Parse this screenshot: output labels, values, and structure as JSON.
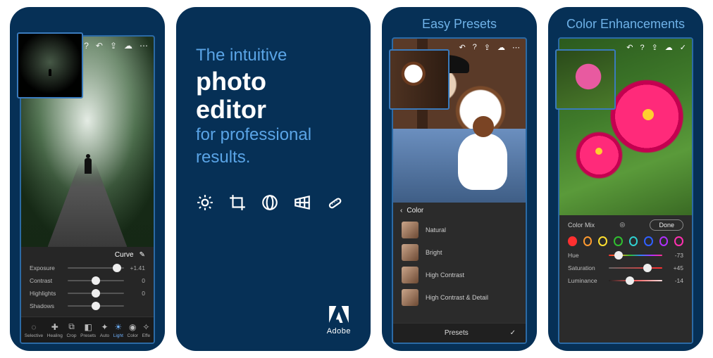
{
  "panel1": {
    "top_icons": [
      "help-icon",
      "undo-icon",
      "share-icon",
      "cloud-icon",
      "more-icon"
    ],
    "edit_header_label": "Curve",
    "sliders": [
      {
        "label": "Exposure",
        "value": "+1.41",
        "pos": 88
      },
      {
        "label": "Contrast",
        "value": "0",
        "pos": 50
      },
      {
        "label": "Highlights",
        "value": "0",
        "pos": 50
      },
      {
        "label": "Shadows",
        "value": "",
        "pos": 50
      }
    ],
    "bottom_tools": [
      {
        "name": "selective",
        "label": "Selective"
      },
      {
        "name": "healing",
        "label": "Healing"
      },
      {
        "name": "crop",
        "label": "Crop"
      },
      {
        "name": "presets",
        "label": "Presets"
      },
      {
        "name": "auto",
        "label": "Auto"
      },
      {
        "name": "light",
        "label": "Light"
      },
      {
        "name": "color",
        "label": "Color"
      },
      {
        "name": "effects",
        "label": "Effe"
      }
    ],
    "active_tool": "light"
  },
  "panel2": {
    "line1": "The intuitive",
    "line2": "photo",
    "line3": "editor",
    "line4": "for professional",
    "line5": "results.",
    "tool_icons": [
      "brightness-icon",
      "crop-icon",
      "lens-icon",
      "grid-icon",
      "heal-icon"
    ],
    "brand_name": "Adobe"
  },
  "panel3": {
    "title": "Easy Presets",
    "top_icons": [
      "undo-icon",
      "help-icon",
      "share-icon",
      "cloud-icon",
      "more-icon"
    ],
    "section_label": "Color",
    "presets": [
      {
        "label": "Natural"
      },
      {
        "label": "Bright"
      },
      {
        "label": "High Contrast"
      },
      {
        "label": "High Contrast & Detail"
      }
    ],
    "footer_label": "Presets"
  },
  "panel4": {
    "title": "Color Enhancements",
    "top_icons": [
      "undo-icon",
      "help-icon",
      "share-icon",
      "cloud-icon",
      "check-icon"
    ],
    "group_label": "Color Mix",
    "target_icon": "target-icon",
    "done_label": "Done",
    "swatches": [
      "#ff3030",
      "#ff9a30",
      "#ffe030",
      "#30c030",
      "#30d0d0",
      "#3060ff",
      "#b030ff",
      "#ff30b0"
    ],
    "selected_swatch": 0,
    "sliders": [
      {
        "label": "Hue",
        "value": "-73",
        "pos": 18,
        "track": "hue"
      },
      {
        "label": "Saturation",
        "value": "+45",
        "pos": 72,
        "track": "gray"
      },
      {
        "label": "Luminance",
        "value": "-14",
        "pos": 40,
        "track": "lum"
      }
    ]
  }
}
